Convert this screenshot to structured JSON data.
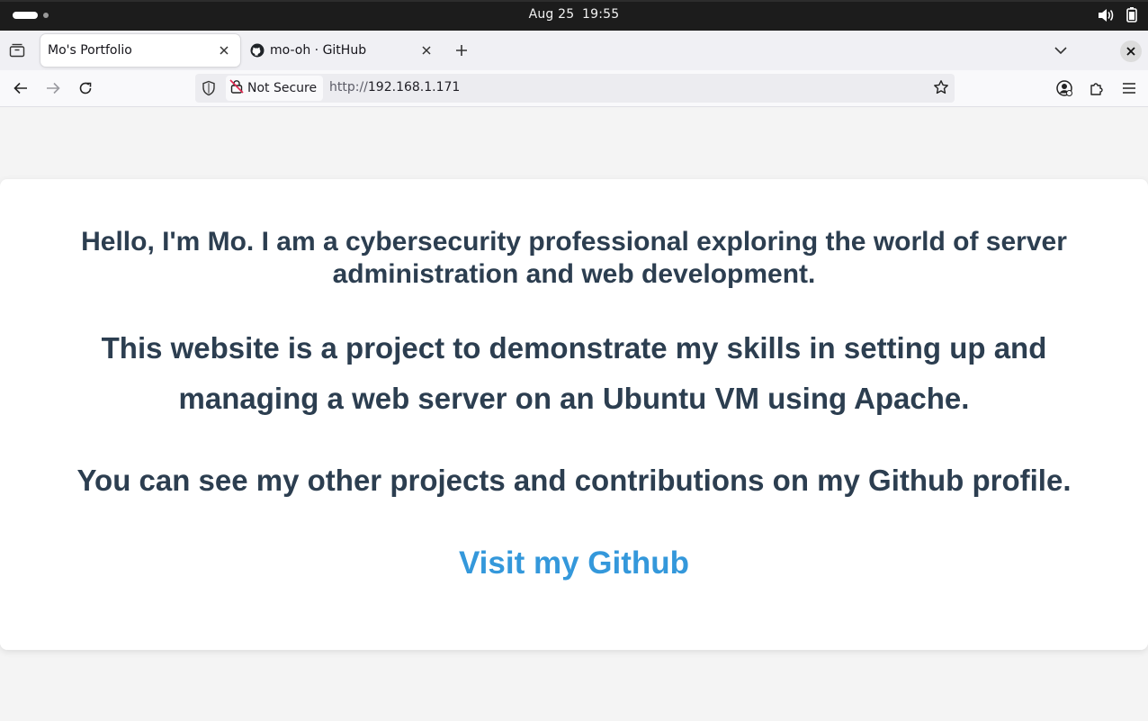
{
  "system": {
    "date": "Aug 25",
    "time": "19:55",
    "icons": [
      "volume-icon",
      "battery-icon"
    ]
  },
  "tabs": [
    {
      "title": "Mo's Portfolio",
      "active": true
    },
    {
      "title": "mo-oh · GitHub",
      "active": false,
      "favicon": "github-icon"
    }
  ],
  "navbar": {
    "security_label": "Not Secure",
    "url_scheme": "http://",
    "url_host": "192.168.1.171"
  },
  "content": {
    "intro": "Hello, I'm Mo. I am a cybersecurity professional exploring the world of server administration and web development.",
    "project": "This website is a project to demonstrate my skills in setting up and managing a web server on an Ubuntu VM using Apache.",
    "profile": "You can see my other projects and contributions on my Github profile.",
    "link_label": "Visit my Github"
  },
  "colors": {
    "heading": "#2c3e50",
    "link": "#3498db",
    "topbar": "#1c1c1c",
    "page_bg": "#f4f4f4"
  }
}
